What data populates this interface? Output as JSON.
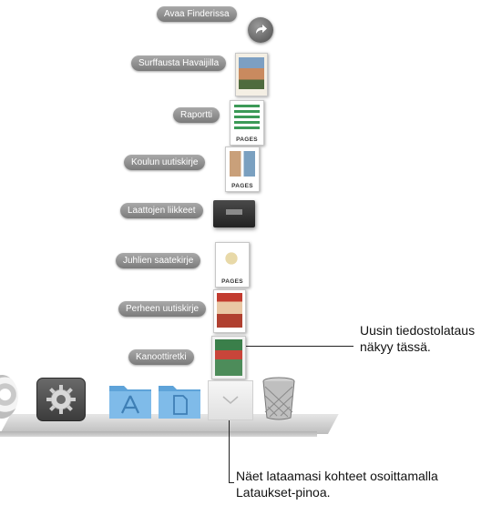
{
  "stack": {
    "items": [
      {
        "label": "Avaa Finderissa"
      },
      {
        "label": "Surffausta Havaijilla"
      },
      {
        "label": "Raportti"
      },
      {
        "label": "Koulun uutiskirje"
      },
      {
        "label": "Laattojen liikkeet"
      },
      {
        "label": "Juhlien saatekirje"
      },
      {
        "label": "Perheen uutiskirje"
      },
      {
        "label": "Kanoottiretki"
      }
    ],
    "pages_tag": "PAGES"
  },
  "callouts": {
    "newest": {
      "line1": "Uusin tiedostolataus",
      "line2": "näkyy tässä."
    },
    "downloads": {
      "line1": "Näet lataamasi kohteet osoittamalla",
      "line2": "Lataukset-pinoa."
    }
  },
  "colors": {
    "label_bg": "#8d8d8d",
    "folder_blue": "#6fb2e6"
  }
}
